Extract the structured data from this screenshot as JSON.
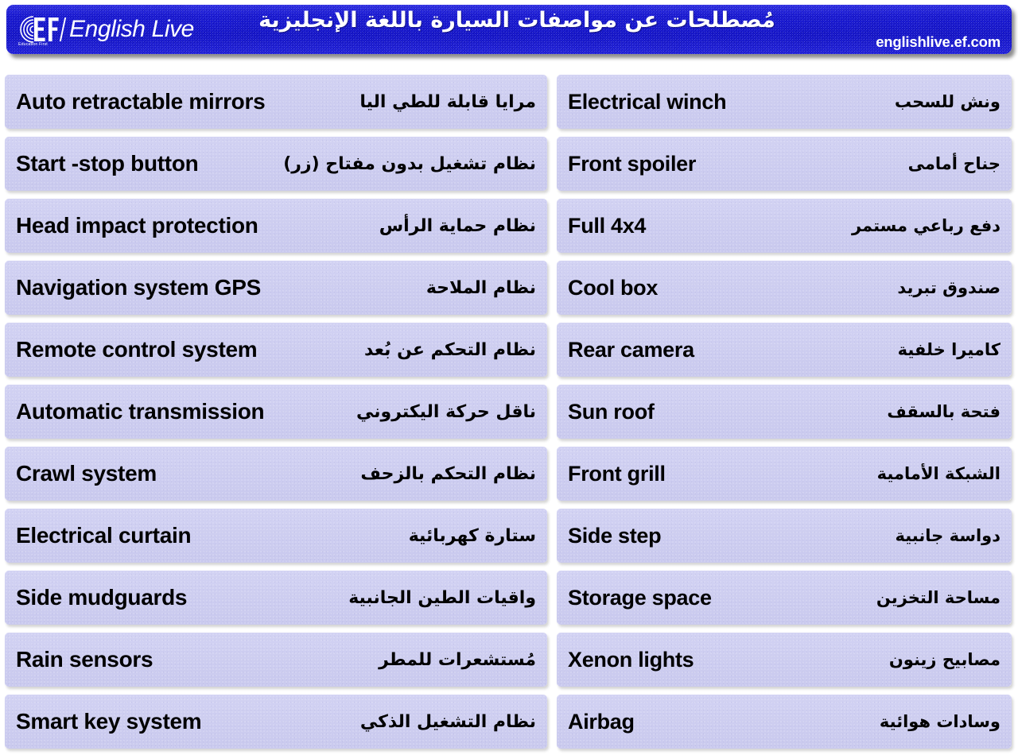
{
  "header": {
    "brand_name": "English Live",
    "brand_logo_icon": "ef-education-first-logo",
    "brand_tagline": "Education First",
    "title_ar": "مُصطلحات عن مواصفات السيارة باللغة الإنجليزية",
    "url": "englishlive.ef.com",
    "background_color": "#1010d4",
    "text_color": "#ffffff"
  },
  "table": {
    "row_background_color": "#cdcdf0",
    "row_text_color": "#000000",
    "left_column": [
      {
        "en": "Auto retractable mirrors",
        "ar": "مرايا قابلة للطي اليا"
      },
      {
        "en": "Start -stop button",
        "ar": "نظام تشغيل بدون مفتاح (زر)"
      },
      {
        "en": "Head impact protection",
        "ar": "نظام حماية الرأس"
      },
      {
        "en": "Navigation system GPS",
        "ar": "نظام الملاحة"
      },
      {
        "en": "Remote control system",
        "ar": "نظام التحكم عن بُعد"
      },
      {
        "en": "Automatic transmission",
        "ar": "ناقل حركة اليكتروني"
      },
      {
        "en": "Crawl system",
        "ar": "نظام التحكم بالزحف"
      },
      {
        "en": "Electrical curtain",
        "ar": "ستارة كهربائية"
      },
      {
        "en": "Side mudguards",
        "ar": "واقيات الطين الجانبية"
      },
      {
        "en": "Rain sensors",
        "ar": "مُستشعرات للمطر"
      },
      {
        "en": "Smart key system",
        "ar": "نظام التشغيل الذكي"
      }
    ],
    "right_column": [
      {
        "en": "Electrical winch",
        "ar": "ونش للسحب"
      },
      {
        "en": "Front spoiler",
        "ar": "جناح أمامى"
      },
      {
        "en": "Full 4x4",
        "ar": "دفع رباعي مستمر"
      },
      {
        "en": "Cool box",
        "ar": "صندوق تبريد"
      },
      {
        "en": "Rear camera",
        "ar": "كاميرا خلفية"
      },
      {
        "en": "Sun roof",
        "ar": "فتحة بالسقف"
      },
      {
        "en": "Front grill",
        "ar": "الشبكة الأمامية"
      },
      {
        "en": "Side step",
        "ar": "دواسة جانبية"
      },
      {
        "en": "Storage space",
        "ar": "مساحة التخزين"
      },
      {
        "en": "Xenon lights",
        "ar": "مصابيح زينون"
      },
      {
        "en": "Airbag",
        "ar": "وسادات هوائية"
      }
    ]
  }
}
